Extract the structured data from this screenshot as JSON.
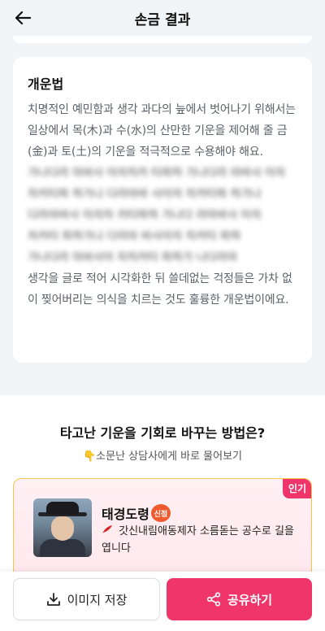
{
  "header": {
    "title": "손금 결과",
    "back_icon": "arrow-left-icon"
  },
  "card": {
    "title": "개운법",
    "text_top": "치명적인 예민함과 생각 과다의 늪에서 벗어나기 위해서는 일상에서 목(木)과 수(水)의 산만한 기운을 제어해 줄 금(金)과 토(土)의 기운을 적극적으로 수용해야 해요.",
    "text_bottom": "생각을 글로 적어 시각화한 뒤 쓸데없는 걱정들은 가차 없이 찢어버리는 의식을 치르는 것도 훌륭한 개운법이에요."
  },
  "section": {
    "title": "타고난 기운을 기회로 바꾸는 방법은?",
    "subtitle": "👇소문난 상담사에게 바로 물어보기"
  },
  "counselor": {
    "badge": "인기",
    "name": "태경도령",
    "new_badge": "신점",
    "description": "갓신내림애동제자 소름돋는 공수로 길을 엽니다",
    "feather_icon": "feather-icon"
  },
  "bottom_bar": {
    "save_label": "이미지 저장",
    "share_label": "공유하기",
    "download_icon": "download-icon",
    "share_icon": "share-icon",
    "accent_color": "#f0356b"
  }
}
